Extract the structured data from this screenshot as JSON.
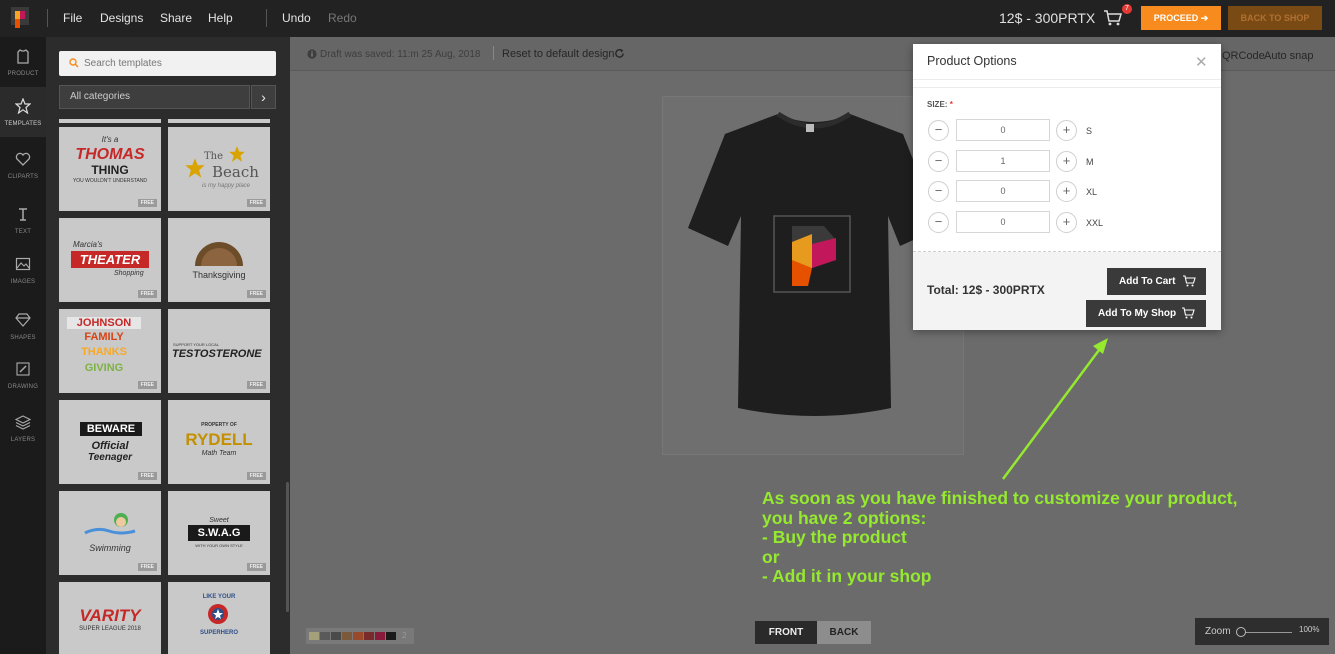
{
  "topbar": {
    "menu": [
      "File",
      "Designs",
      "Share",
      "Help"
    ],
    "undo": "Undo",
    "redo": "Redo",
    "price": "12$ - 300PRTX",
    "cart_count": "7",
    "proceed": "PROCEED",
    "back_to_shop": "BACK TO SHOP"
  },
  "rail": [
    {
      "label": "PRODUCT",
      "icon": "shirt-icon"
    },
    {
      "label": "TEMPLATES",
      "icon": "star-icon"
    },
    {
      "label": "CLIPARTS",
      "icon": "heart-icon"
    },
    {
      "label": "TEXT",
      "icon": "text-icon"
    },
    {
      "label": "IMAGES",
      "icon": "image-icon"
    },
    {
      "label": "SHAPES",
      "icon": "diamond-icon"
    },
    {
      "label": "DRAWING",
      "icon": "pencil-icon"
    },
    {
      "label": "LAYERS",
      "icon": "layers-icon"
    }
  ],
  "panel": {
    "search_placeholder": "Search templates",
    "category": "All categories",
    "free_badge": "FREE",
    "templates": [
      {
        "line1": "It's a",
        "line2": "THOMAS",
        "line3": "THING",
        "line4": "YOU WOULDN'T UNDERSTAND"
      },
      {
        "line1": "The",
        "line2": "Beach",
        "line3": "is my happy place"
      },
      {
        "line1": "Marcia's",
        "line2": "THEATER",
        "line3": "Shopping"
      },
      {
        "line1": "Thanksgiving"
      },
      {
        "line1": "JOHNSON",
        "line2": "FAMILY",
        "line3": "THANKS",
        "line4": "GIVING"
      },
      {
        "line1": "SUPPORT YOUR LOCAL",
        "line2": "TESTOSTERONE"
      },
      {
        "line1": "BEWARE",
        "line2": "Official",
        "line3": "Teenager"
      },
      {
        "line1": "PROPERTY OF",
        "line2": "RYDELL",
        "line3": "Math Team"
      },
      {
        "line1": "Swimming"
      },
      {
        "line1": "Sweet",
        "line2": "S.W.A.G",
        "line3": "WITH YOUR OWN STYLE"
      },
      {
        "line1": "VARITY",
        "line2": "SUPER LEAGUE 2018"
      },
      {
        "line1": "LIKE YOUR",
        "line2": "SUPERHERO"
      }
    ]
  },
  "canvas": {
    "draft": "Draft was saved: 11:m 25 Aug, 2018",
    "reset": "Reset to default design",
    "qrcode": "QRCode",
    "autosnap": "Auto snap",
    "swatch_count": "2",
    "front": "FRONT",
    "back": "BACK",
    "zoom_label": "Zoom",
    "zoom_value": "100%"
  },
  "colors": {
    "swatches": [
      "#a4a07a",
      "#5a5a5a",
      "#4a4a4a",
      "#7a5a3a",
      "#9a4a2a",
      "#7a2a2a",
      "#8a1a3a",
      "#1a1a1a"
    ],
    "accent": "#f78b1d",
    "annotation": "#95ea2f"
  },
  "modal": {
    "title": "Product Options",
    "size_label": "SIZE:",
    "required_mark": "*",
    "sizes": [
      {
        "name": "S",
        "qty": "0"
      },
      {
        "name": "M",
        "qty": "1"
      },
      {
        "name": "XL",
        "qty": "0"
      },
      {
        "name": "XXL",
        "qty": "0"
      }
    ],
    "total": "Total: 12$ - 300PRTX",
    "add_to_cart": "Add To Cart",
    "add_to_shop": "Add To My Shop"
  },
  "annotation": {
    "lines": [
      "As soon as you have finished to customize your product,",
      "you have 2 options:",
      "- Buy the product",
      "or",
      "- Add it in your shop"
    ]
  }
}
